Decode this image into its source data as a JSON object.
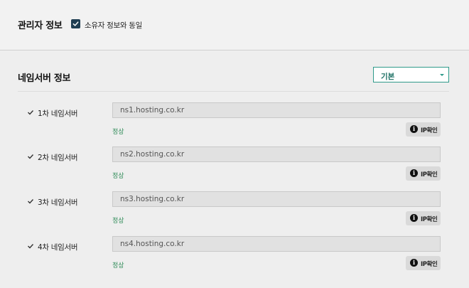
{
  "admin": {
    "title": "관리자 정보",
    "same_as_owner_label": "소유자 정보와 동일",
    "same_as_owner_checked": true
  },
  "nameserver": {
    "title": "네임서버 정보",
    "preset_selected": "기본",
    "rows": [
      {
        "label": "1차 네임서버",
        "value": "ns1.hosting.co.kr",
        "status": "정상",
        "button_label": "IP확인"
      },
      {
        "label": "2차 네임서버",
        "value": "ns2.hosting.co.kr",
        "status": "정상",
        "button_label": "IP확인"
      },
      {
        "label": "3차 네임서버",
        "value": "ns3.hosting.co.kr",
        "status": "정상",
        "button_label": "IP확인"
      },
      {
        "label": "4차 네임서버",
        "value": "ns4.hosting.co.kr",
        "status": "정상",
        "button_label": "IP확인"
      }
    ]
  },
  "colors": {
    "accent": "#2f9a8a",
    "status_ok": "#2e8b57",
    "checkbox": "#1f3e52"
  },
  "icons": {
    "checkbox": "checkmark-icon",
    "row_tick": "check-icon",
    "ip_button": "info-icon",
    "select": "chevron-down-icon"
  }
}
